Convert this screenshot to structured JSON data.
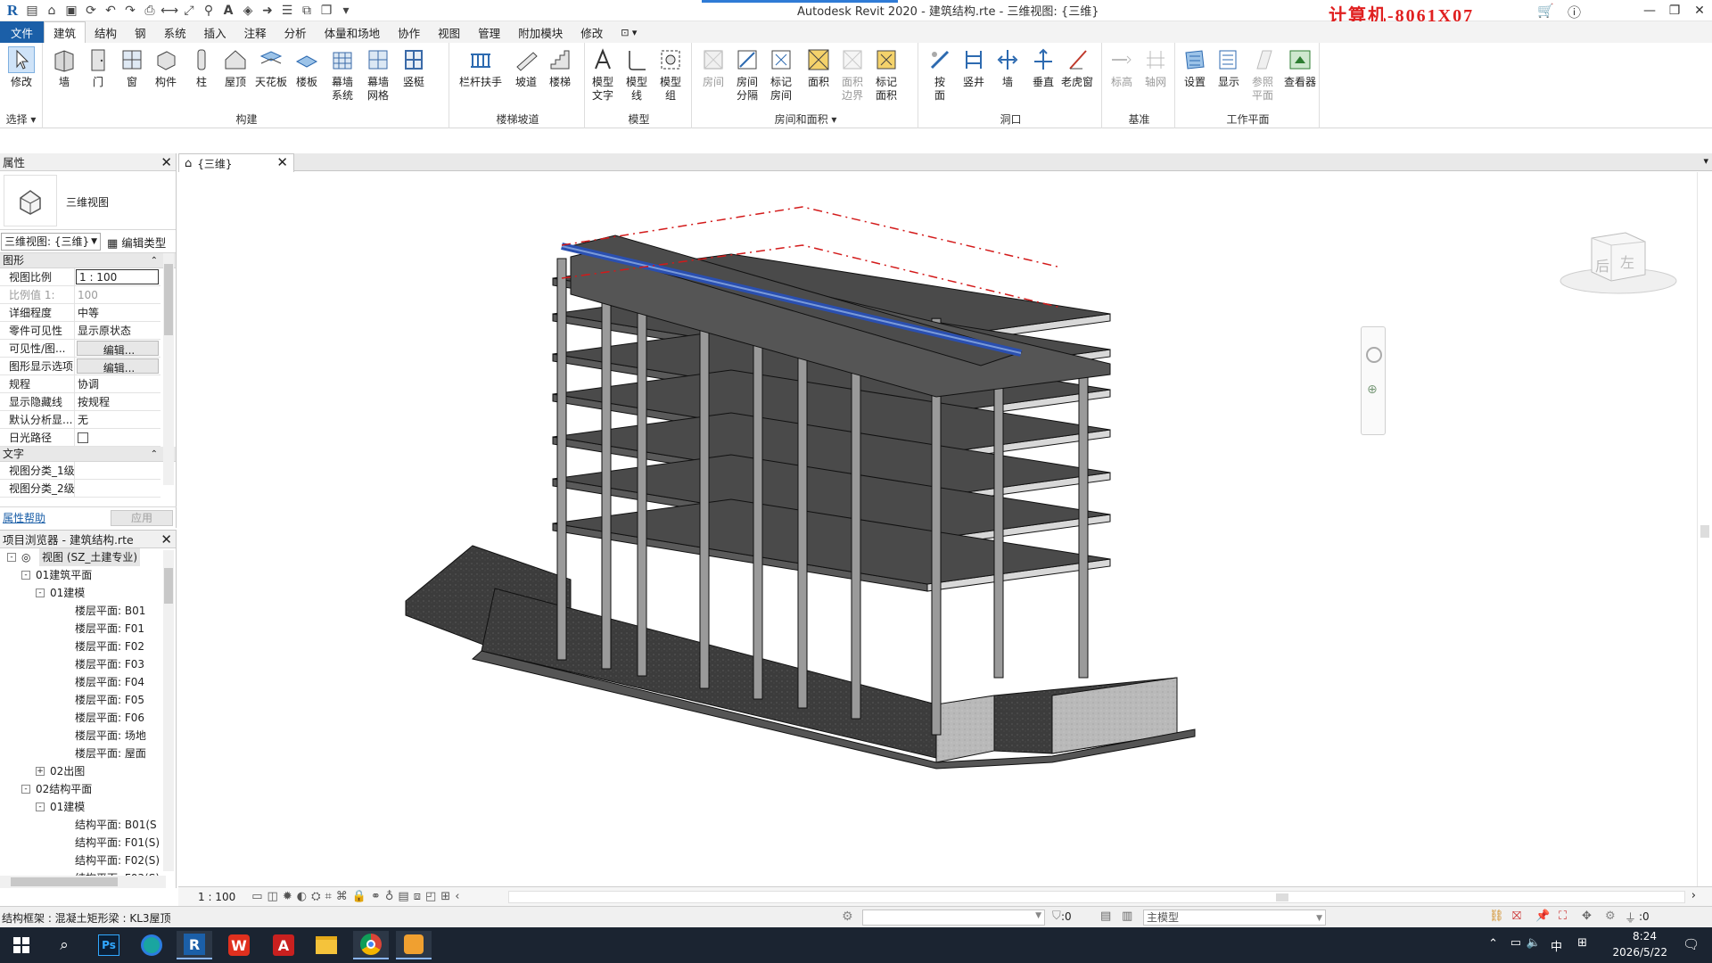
{
  "app": {
    "title": "Autodesk Revit 2020 - 建筑结构.rte - 三维视图: {三维}",
    "watermark": "计算机-8061X07"
  },
  "menu_tabs": [
    "文件",
    "建筑",
    "结构",
    "钢",
    "系统",
    "插入",
    "注释",
    "分析",
    "体量和场地",
    "协作",
    "视图",
    "管理",
    "附加模块",
    "修改"
  ],
  "active_tab": "建筑",
  "ribbon": {
    "panels": {
      "select": "选择 ▾",
      "build": "构建",
      "circulation": "楼梯坡道",
      "model": "模型",
      "room_area": "房间和面积 ▾",
      "opening": "洞口",
      "datum": "基准",
      "workplane": "工作平面"
    },
    "buttons": {
      "modify": "修改",
      "wall": "墙",
      "door": "门",
      "window": "窗",
      "component": "构件",
      "column": "柱",
      "roof": "屋顶",
      "ceiling": "天花板",
      "floor": "楼板",
      "curtain_system": "幕墙\n系统",
      "curtain_grid": "幕墙\n网格",
      "mullion": "竖梃",
      "railing": "栏杆扶手",
      "ramp": "坡道",
      "stair": "楼梯",
      "model_text": "模型\n文字",
      "model_line": "模型\n线",
      "model_group": "模型\n组",
      "room": "房间",
      "room_separator": "房间\n分隔",
      "tag_room": "标记\n房间",
      "area": "面积",
      "area_boundary": "面积\n边界",
      "tag_area": "标记\n面积",
      "by_face": "按\n面",
      "shaft": "竖井",
      "wall_opening": "墙",
      "vertical": "垂直",
      "dormer": "老虎窗",
      "level": "标高",
      "grid": "轴网",
      "set": "设置",
      "show": "显示",
      "ref_plane": "参照\n平面",
      "viewer": "查看器"
    }
  },
  "properties": {
    "header": "属性",
    "type_name": "三维视图",
    "type_selector": "三维视图: {三维}",
    "edit_type": "编辑类型",
    "group_graphics": "图形",
    "rows": [
      {
        "k": "视图比例",
        "v": "1 : 100"
      },
      {
        "k": "比例值 1:",
        "v": "100"
      },
      {
        "k": "详细程度",
        "v": "中等"
      },
      {
        "k": "零件可见性",
        "v": "显示原状态"
      },
      {
        "k": "可见性/图...",
        "v": "编辑..."
      },
      {
        "k": "图形显示选项",
        "v": "编辑..."
      },
      {
        "k": "规程",
        "v": "协调"
      },
      {
        "k": "显示隐藏线",
        "v": "按规程"
      },
      {
        "k": "默认分析显...",
        "v": "无"
      },
      {
        "k": "日光路径",
        "v": ""
      }
    ],
    "group_text": "文字",
    "text_rows": [
      {
        "k": "视图分类_1级",
        "v": ""
      },
      {
        "k": "视图分类_2级",
        "v": ""
      }
    ],
    "help": "属性帮助",
    "apply": "应用"
  },
  "browser": {
    "header": "项目浏览器 - 建筑结构.rte",
    "items": [
      {
        "t": "视图 (SZ_土建专业)",
        "lvl": 0,
        "tog": "-"
      },
      {
        "t": "01建筑平面",
        "lvl": 1,
        "tog": "-"
      },
      {
        "t": "01建模",
        "lvl": 2,
        "tog": "-"
      },
      {
        "t": "楼层平面: B01",
        "lvl": 3,
        "tog": ""
      },
      {
        "t": "楼层平面: F01",
        "lvl": 3,
        "tog": ""
      },
      {
        "t": "楼层平面: F02",
        "lvl": 3,
        "tog": ""
      },
      {
        "t": "楼层平面: F03",
        "lvl": 3,
        "tog": ""
      },
      {
        "t": "楼层平面: F04",
        "lvl": 3,
        "tog": ""
      },
      {
        "t": "楼层平面: F05",
        "lvl": 3,
        "tog": ""
      },
      {
        "t": "楼层平面: F06",
        "lvl": 3,
        "tog": ""
      },
      {
        "t": "楼层平面: 场地",
        "lvl": 3,
        "tog": ""
      },
      {
        "t": "楼层平面: 屋面",
        "lvl": 3,
        "tog": ""
      },
      {
        "t": "02出图",
        "lvl": 2,
        "tog": "+"
      },
      {
        "t": "02结构平面",
        "lvl": 1,
        "tog": "-"
      },
      {
        "t": "01建模",
        "lvl": 2,
        "tog": "-"
      },
      {
        "t": "结构平面: B01(S",
        "lvl": 3,
        "tog": ""
      },
      {
        "t": "结构平面: F01(S)",
        "lvl": 3,
        "tog": ""
      },
      {
        "t": "结构平面: F02(S)",
        "lvl": 3,
        "tog": ""
      },
      {
        "t": "结构平面: F03(S)",
        "lvl": 3,
        "tog": ""
      }
    ]
  },
  "view_tab": {
    "label": "{三维}"
  },
  "viewcube": {
    "left": "左",
    "back": "后"
  },
  "view_bar": {
    "scale": "1 : 100"
  },
  "status": {
    "text": "结构框架 : 混凝土矩形梁 : KL3屋顶",
    "zero": ":0",
    "model": "主模型",
    "filter": ":0"
  },
  "taskbar": {
    "apps": [
      "Windows",
      "搜索",
      "Photoshop",
      "Edge",
      "Revit",
      "WPS",
      "Acrobat",
      "文件资源管理器",
      "Chrome",
      "其他"
    ],
    "ime": "中",
    "time": "8:24",
    "date": "2026/5/22"
  },
  "colors": {
    "file_tab": "#1b5fa8",
    "selection": "#2a4fb0",
    "level_line": "#d31a1a",
    "watermark": "#e02020",
    "taskbar": "#1b2431"
  }
}
